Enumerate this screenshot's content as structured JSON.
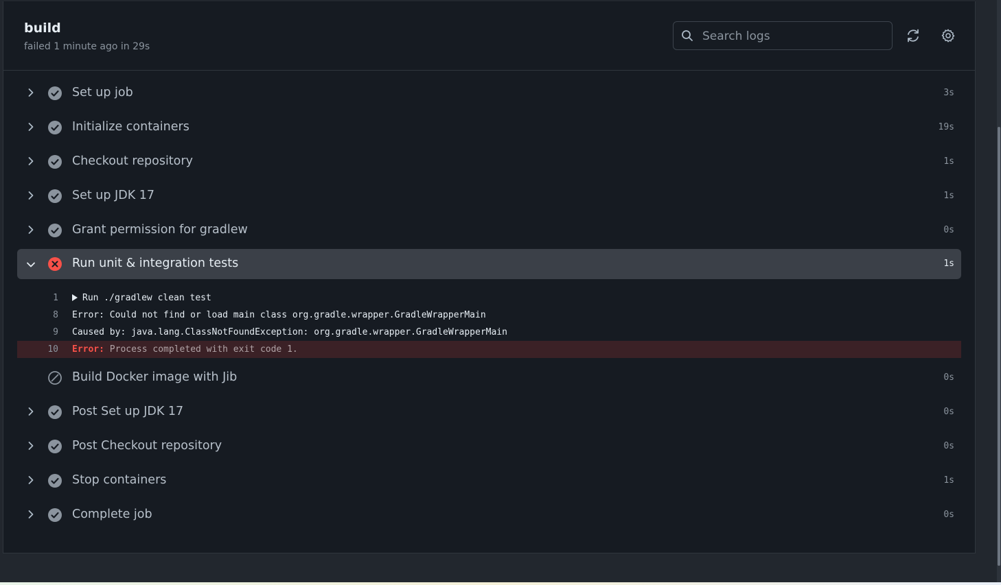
{
  "job": {
    "title": "build",
    "subtitle": "failed 1 minute ago in 29s"
  },
  "search": {
    "placeholder": "Search logs"
  },
  "icons": {
    "refresh": "refresh-icon",
    "settings": "gear-icon"
  },
  "colors": {
    "success": "#8b949e",
    "failure": "#f85149",
    "background": "#161b22",
    "active_row": "#3b4048",
    "error_row": "#3b2126"
  },
  "steps_before": [
    {
      "name": "Set up job",
      "duration": "3s",
      "status": "success"
    },
    {
      "name": "Initialize containers",
      "duration": "19s",
      "status": "success"
    },
    {
      "name": "Checkout repository",
      "duration": "1s",
      "status": "success"
    },
    {
      "name": "Set up JDK 17",
      "duration": "1s",
      "status": "success"
    },
    {
      "name": "Grant permission for gradlew",
      "duration": "0s",
      "status": "success"
    }
  ],
  "active_step": {
    "name": "Run unit & integration tests",
    "duration": "1s",
    "status": "failure",
    "logs": [
      {
        "line": "1",
        "text": "Run ./gradlew clean test",
        "group": true
      },
      {
        "line": "8",
        "text": "Error: Could not find or load main class org.gradle.wrapper.GradleWrapperMain"
      },
      {
        "line": "9",
        "text": "Caused by: java.lang.ClassNotFoundException: org.gradle.wrapper.GradleWrapperMain"
      },
      {
        "line": "10",
        "keyword": "Error:",
        "text": " Process completed with exit code 1.",
        "error": true
      }
    ]
  },
  "steps_after": [
    {
      "name": "Build Docker image with Jib",
      "duration": "0s",
      "status": "skipped"
    },
    {
      "name": "Post Set up JDK 17",
      "duration": "0s",
      "status": "success"
    },
    {
      "name": "Post Checkout repository",
      "duration": "0s",
      "status": "success"
    },
    {
      "name": "Stop containers",
      "duration": "1s",
      "status": "success"
    },
    {
      "name": "Complete job",
      "duration": "0s",
      "status": "success"
    }
  ]
}
